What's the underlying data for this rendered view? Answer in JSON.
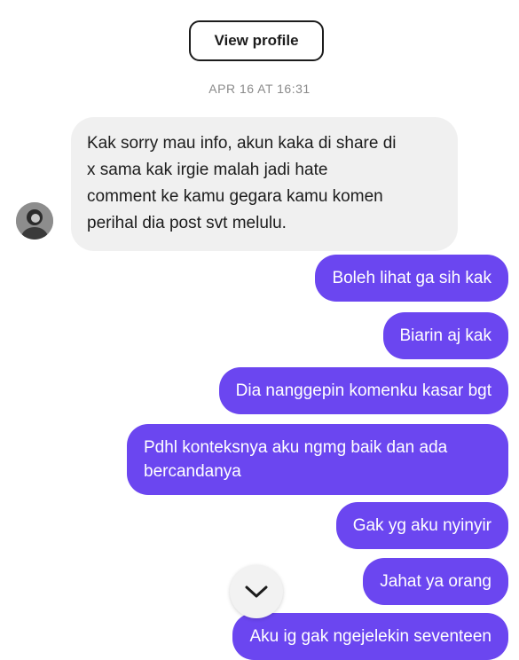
{
  "header": {
    "view_profile_label": "View profile"
  },
  "timestamp": "APR 16 AT 16:31",
  "incoming_message": {
    "lines": [
      "Kak sorry mau info, akun kaka di share di",
      "x sama kak irgie malah jadi hate",
      "comment ke kamu gegara kamu komen",
      "perihal dia post svt melulu."
    ]
  },
  "outgoing_messages": [
    {
      "text": "Boleh lihat ga sih kak"
    },
    {
      "text": "Biarin aj kak"
    },
    {
      "text": "Dia nanggepin komenku kasar bgt"
    },
    {
      "lines": [
        "Pdhl konteksnya aku ngmg baik dan ada",
        "bercandanya"
      ]
    },
    {
      "text": "Gak yg aku nyinyir"
    },
    {
      "text": "Jahat ya orang"
    },
    {
      "text": "Aku ig gak ngejelekin seventeen"
    }
  ],
  "icons": {
    "avatar": "user-avatar",
    "scroll_down": "chevron-down-icon"
  },
  "colors": {
    "outgoing_bubble": "#6b46f0",
    "incoming_bubble": "#f0f0f0",
    "timestamp_text": "#8a8a8a"
  }
}
